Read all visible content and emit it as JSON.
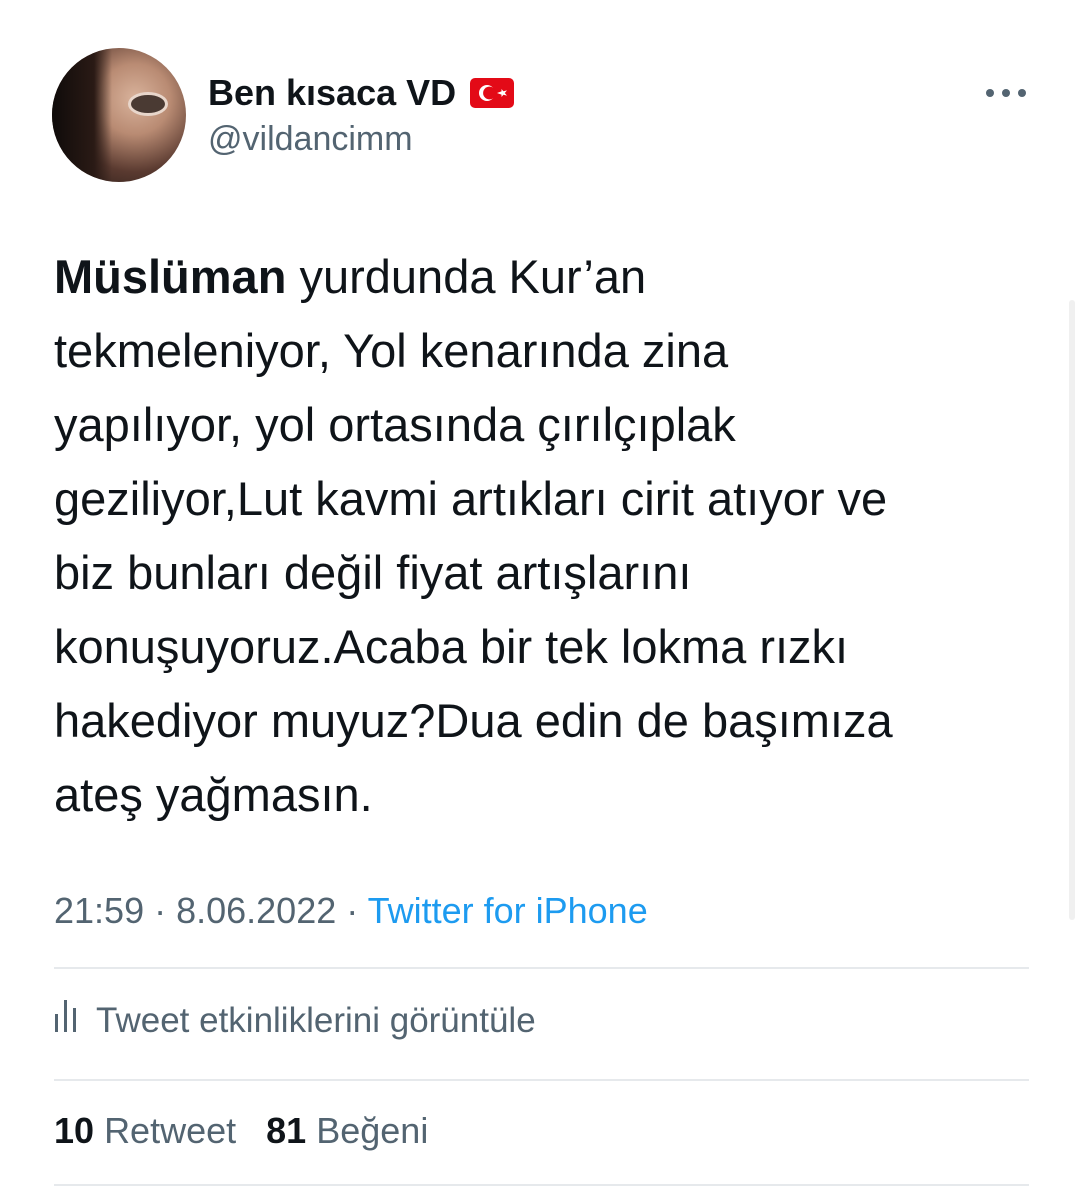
{
  "user": {
    "display_name": "Ben kısaca VD",
    "flag_icon": "turkey-flag-icon",
    "handle": "@vildancimm"
  },
  "tweet": {
    "bold_word": "Müslüman",
    "lines": [
      " yurdunda Kur’an",
      "tekmeleniyor, Yol kenarında zina",
      "yapılıyor, yol ortasında çırılçıplak",
      "geziliyor,Lut kavmi artıkları cirit atıyor ve",
      "biz bunları değil fiyat artışlarını",
      "konuşuyoruz.Acaba bir tek lokma rızkı",
      "hakediyor muyuz?Dua edin de başımıza",
      "ateş yağmasın."
    ]
  },
  "meta": {
    "time": "21:59",
    "separator": " · ",
    "date": "8.06.2022",
    "source": "Twitter for iPhone"
  },
  "analytics": {
    "icon": "analytics-icon",
    "label": "Tweet etkinliklerini görüntüle"
  },
  "stats": {
    "retweets": "10",
    "retweets_label": "Retweet",
    "likes": "81",
    "likes_label": "Beğeni"
  },
  "colors": {
    "text": "#0f1419",
    "secondary": "#536471",
    "link": "#1d9bf0",
    "divider": "#e6e9ec",
    "flag_red": "#e30a17"
  }
}
